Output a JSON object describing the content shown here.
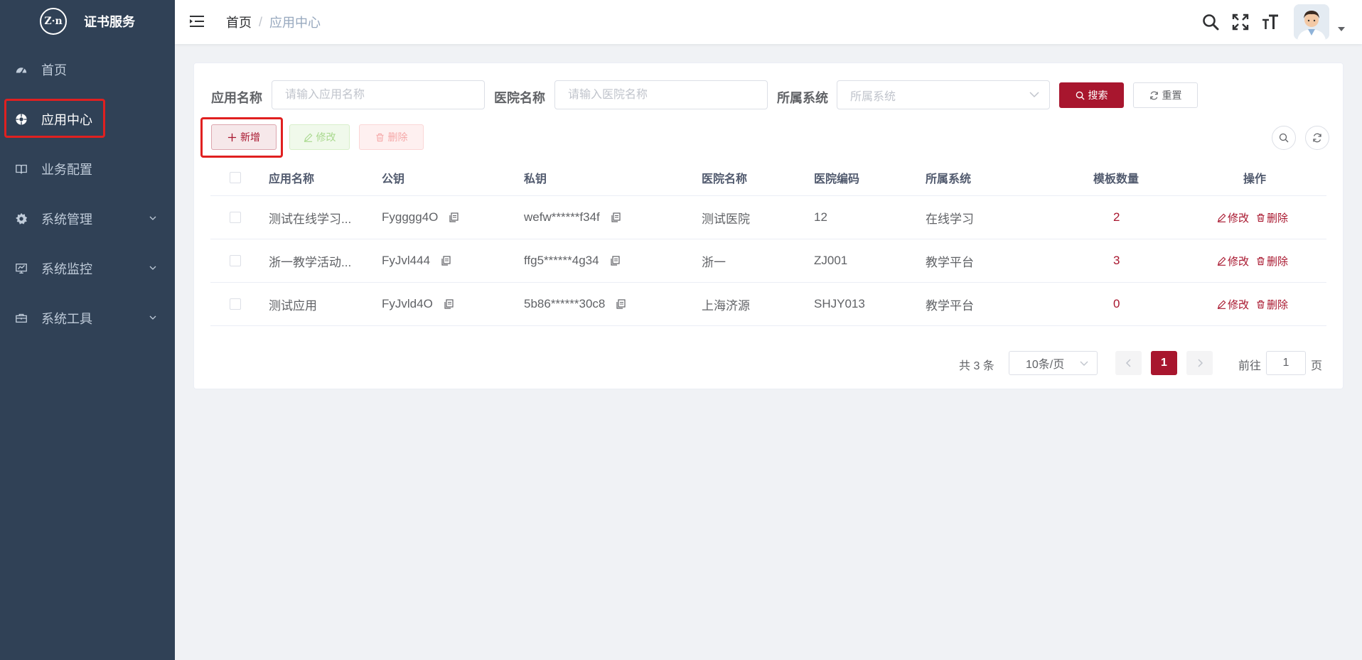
{
  "app": {
    "logo_text": "Z·n",
    "title": "证书服务"
  },
  "sidebar": {
    "items": [
      {
        "label": "首页",
        "icon": "dashboard-icon"
      },
      {
        "label": "应用中心",
        "icon": "app-center-icon",
        "active": true
      },
      {
        "label": "业务配置",
        "icon": "book-icon"
      },
      {
        "label": "系统管理",
        "icon": "gear-icon",
        "expandable": true
      },
      {
        "label": "系统监控",
        "icon": "monitor-icon",
        "expandable": true
      },
      {
        "label": "系统工具",
        "icon": "toolbox-icon",
        "expandable": true
      }
    ]
  },
  "header": {
    "breadcrumb": [
      "首页",
      "应用中心"
    ],
    "breadcrumb_sep": "/",
    "icons": [
      "search-icon",
      "fullscreen-icon",
      "font-size-icon",
      "avatar",
      "chevron-down-icon"
    ]
  },
  "filters": {
    "app_name_label": "应用名称",
    "app_name_placeholder": "请输入应用名称",
    "app_name_value": "",
    "hospital_label": "医院名称",
    "hospital_placeholder": "请输入医院名称",
    "hospital_value": "",
    "system_label": "所属系统",
    "system_placeholder": "所属系统",
    "search_label": "搜索",
    "reset_label": "重置"
  },
  "toolbar": {
    "add_label": "新增",
    "edit_label": "修改",
    "delete_label": "删除"
  },
  "table": {
    "columns": [
      "应用名称",
      "公钥",
      "私钥",
      "医院名称",
      "医院编码",
      "所属系统",
      "模板数量",
      "操作"
    ],
    "rows": [
      {
        "app_name": "测试在线学习...",
        "public_key": "Fygggg4O",
        "private_key": "wefw******f34f",
        "hospital": "测试医院",
        "code": "12",
        "system": "在线学习",
        "templates": "2"
      },
      {
        "app_name": "浙一教学活动...",
        "public_key": "FyJvl444",
        "private_key": "ffg5******4g34",
        "hospital": "浙一",
        "code": "ZJ001",
        "system": "教学平台",
        "templates": "3"
      },
      {
        "app_name": "测试应用",
        "public_key": "FyJvld4O",
        "private_key": "5b86******30c8",
        "hospital": "上海济源",
        "code": "SHJY013",
        "system": "教学平台",
        "templates": "0"
      }
    ],
    "row_actions": {
      "edit": "修改",
      "delete": "删除"
    }
  },
  "pagination": {
    "total_text": "共 3 条",
    "page_size": "10条/页",
    "current_page": "1",
    "goto_label": "前往",
    "goto_value": "1",
    "page_suffix": "页"
  },
  "colors": {
    "sidebar_bg": "#304156",
    "primary": "#a8162e",
    "highlight_box": "#e02020"
  }
}
